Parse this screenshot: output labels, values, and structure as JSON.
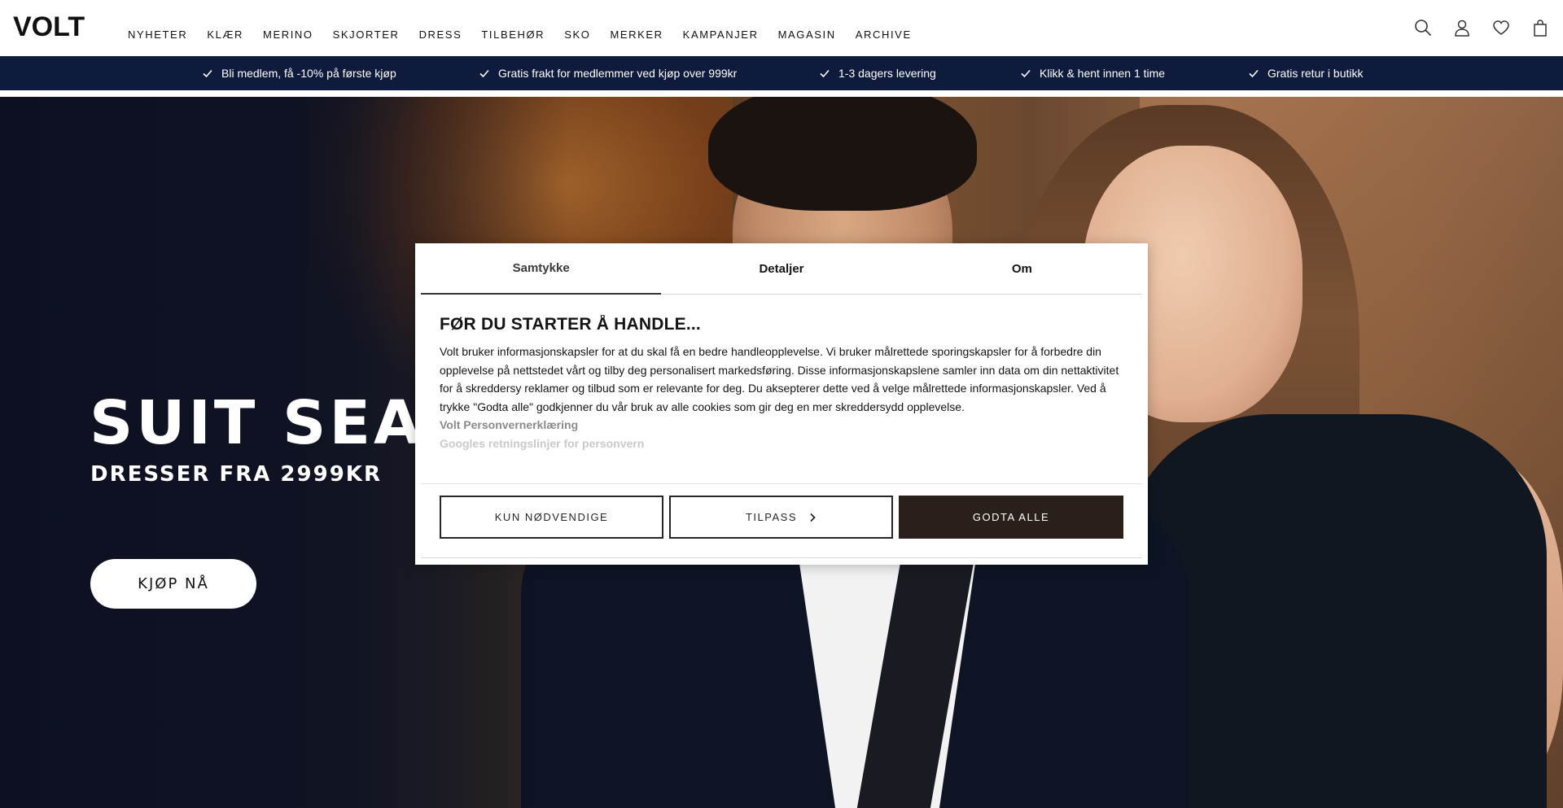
{
  "brand": {
    "logo": "VOLT"
  },
  "nav": {
    "items": [
      "NYHETER",
      "KLÆR",
      "MERINO",
      "SKJORTER",
      "DRESS",
      "TILBEHØR",
      "SKO",
      "MERKER",
      "KAMPANJER",
      "MAGASIN",
      "ARCHIVE"
    ]
  },
  "header_icons": [
    "search-icon",
    "account-icon",
    "wishlist-heart-icon",
    "bag-icon"
  ],
  "usp": [
    "Bli medlem, få -10% på første kjøp",
    "Gratis frakt for medlemmer ved kjøp over 999kr",
    "1-3 dagers levering",
    "Klikk & hent innen 1 time",
    "Gratis retur i butikk"
  ],
  "hero": {
    "title": "SUIT SEASON",
    "subtitle": "DRESSER FRA 2999KR",
    "cta": "KJØP NÅ"
  },
  "cookie": {
    "tabs": [
      "Samtykke",
      "Detaljer",
      "Om"
    ],
    "active_tab": "Samtykke",
    "title": "FØR DU STARTER Å HANDLE...",
    "text": "Volt bruker informasjonskapsler for at du skal få en bedre handleopplevelse. Vi bruker målrettede sporingskapsler for å forbedre din opplevelse på nettstedet vårt og tilby deg personalisert markedsføring. Disse informasjonskapslene samler inn data om din nettaktivitet for å skreddersy reklamer og tilbud som er relevante for deg. Du aksepterer dette ved å velge målrettede informasjonskapsler. Ved å trykke \"Godta alle\" godkjenner du vår bruk av alle cookies som gir deg en mer skreddersydd opplevelse.",
    "links": [
      "Volt Personvernerklæring",
      "Googles retningslinjer for personvern"
    ],
    "buttons": {
      "necessary": "KUN NØDVENDIGE",
      "customize": "TILPASS",
      "accept_all": "GODTA ALLE"
    }
  },
  "colors": {
    "usp_bar": "#0f1b3d",
    "accept_button": "#2a201b",
    "text": "#141414"
  }
}
